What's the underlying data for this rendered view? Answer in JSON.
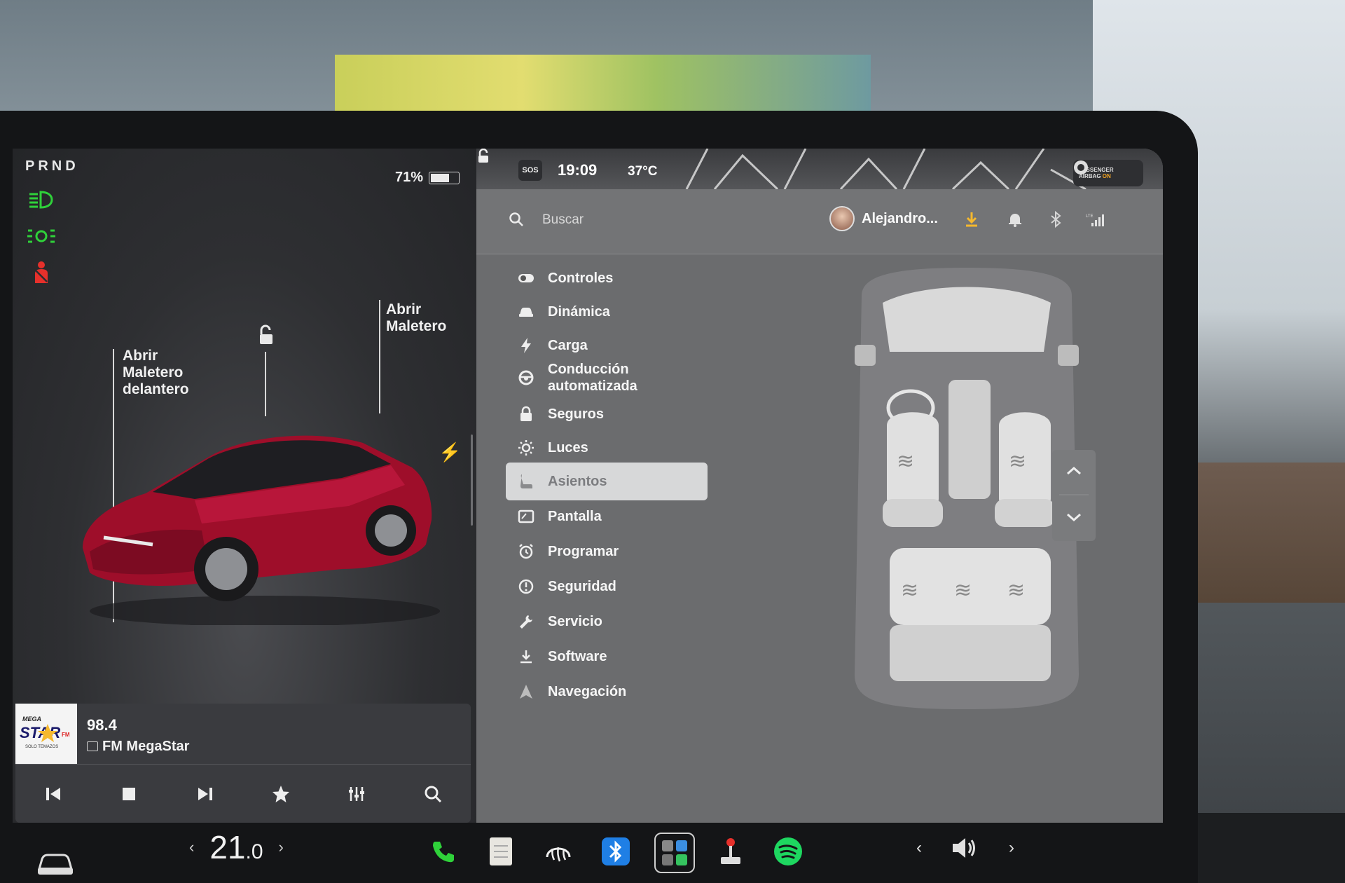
{
  "gear": "PRND",
  "battery": {
    "percent_label": "71%",
    "level": 0.71
  },
  "callouts": {
    "front_trunk": "Abrir\nMaletero\ndelantero",
    "rear_trunk": "Abrir\nMaletero"
  },
  "media": {
    "frequency": "98.4",
    "station": "FM MegaStar",
    "logo_text_top": "MEGA",
    "logo_text_main": "STAR",
    "logo_text_fm": "FM",
    "logo_text_sub": "SOLO TEMAZOS"
  },
  "status": {
    "sos": "SOS",
    "time": "19:09",
    "temperature": "37°C",
    "airbag_line1": "PASSENGER",
    "airbag_line2": "AIRBAG",
    "airbag_state": "ON"
  },
  "search": {
    "placeholder": "Buscar"
  },
  "user": {
    "name": "Alejandro..."
  },
  "menu": [
    {
      "label": "Controles",
      "icon": "toggle-icon"
    },
    {
      "label": "Dinámica",
      "icon": "car-front-icon"
    },
    {
      "label": "Carga",
      "icon": "bolt-icon"
    },
    {
      "label": "Conducción\nautomatizada",
      "icon": "steering-wheel-icon"
    },
    {
      "label": "Seguros",
      "icon": "lock-icon"
    },
    {
      "label": "Luces",
      "icon": "sun-icon"
    },
    {
      "label": "Asientos",
      "icon": "seat-icon",
      "active": true
    },
    {
      "label": "Pantalla",
      "icon": "display-icon"
    },
    {
      "label": "Programar",
      "icon": "alarm-clock-icon"
    },
    {
      "label": "Seguridad",
      "icon": "alert-circle-icon"
    },
    {
      "label": "Servicio",
      "icon": "wrench-icon"
    },
    {
      "label": "Software",
      "icon": "download-icon"
    },
    {
      "label": "Navegación",
      "icon": "navigation-icon"
    }
  ],
  "climate": {
    "temp_whole": "21",
    "temp_decimal": ".0"
  },
  "colors": {
    "accent_green": "#2fd13a",
    "alert_red": "#e6302b",
    "download_yellow": "#f5b82e",
    "spotify_green": "#1ed760"
  }
}
